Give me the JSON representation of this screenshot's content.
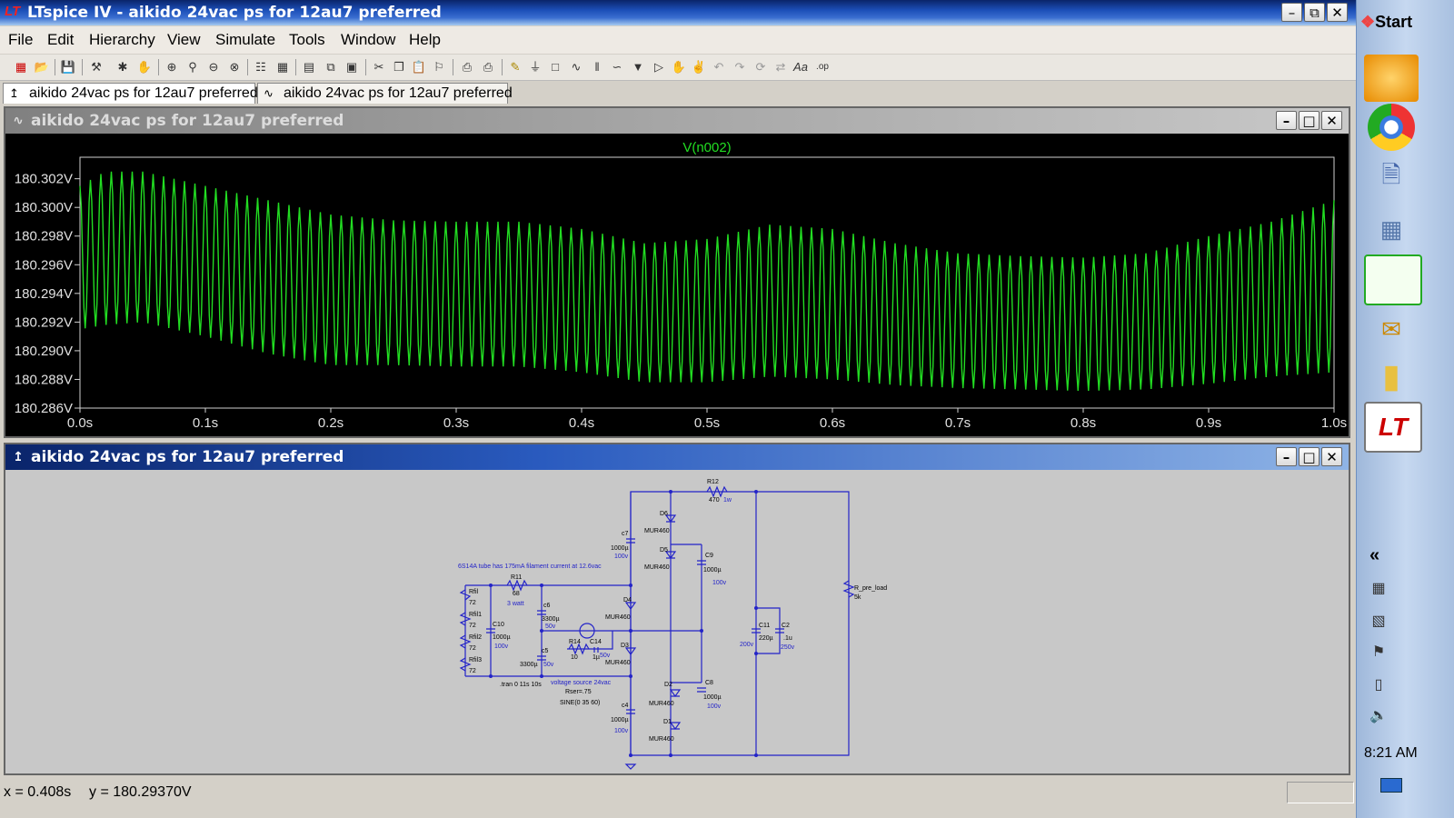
{
  "app": {
    "title": "LTspice IV - aikido 24vac ps for 12au7 preferred",
    "logo": "LT"
  },
  "menu": [
    "File",
    "Edit",
    "Hierarchy",
    "View",
    "Simulate",
    "Tools",
    "Window",
    "Help"
  ],
  "tabs": [
    {
      "label": "aikido 24vac ps for 12au7 preferred",
      "icon": "schematic-icon"
    },
    {
      "label": "aikido 24vac ps for 12au7 preferred",
      "icon": "waveform-icon"
    }
  ],
  "plot_window": {
    "title": "aikido 24vac ps for 12au7 preferred"
  },
  "schematic_window": {
    "title": "aikido 24vac ps for 12au7 preferred"
  },
  "chart_data": {
    "type": "line",
    "title": "V(n002)",
    "series": [
      {
        "name": "V(n002)",
        "color": "#22dd22"
      }
    ],
    "x_range": [
      0.0,
      1.0
    ],
    "y_range": [
      180.286,
      180.3035
    ],
    "x_ticks": [
      "0.0s",
      "0.1s",
      "0.2s",
      "0.3s",
      "0.4s",
      "0.5s",
      "0.6s",
      "0.7s",
      "0.8s",
      "0.9s",
      "1.0s"
    ],
    "y_ticks": [
      "180.302V",
      "180.300V",
      "180.298V",
      "180.296V",
      "180.294V",
      "180.292V",
      "180.290V",
      "180.288V",
      "180.286V"
    ],
    "y_tick_values": [
      180.302,
      180.3,
      180.298,
      180.296,
      180.294,
      180.292,
      180.29,
      180.288,
      180.286
    ],
    "ripple_cycles": 120,
    "envelope": {
      "x": [
        0.0,
        0.02,
        0.05,
        0.1,
        0.15,
        0.2,
        0.25,
        0.3,
        0.35,
        0.4,
        0.45,
        0.5,
        0.55,
        0.6,
        0.65,
        0.7,
        0.75,
        0.8,
        0.85,
        0.9,
        0.95,
        1.0
      ],
      "max": [
        180.3015,
        180.3025,
        180.3025,
        180.3015,
        180.3005,
        180.2995,
        180.2991,
        180.299,
        180.299,
        180.2985,
        180.2975,
        180.2978,
        180.2988,
        180.2985,
        180.2975,
        180.2968,
        180.2966,
        180.2965,
        180.2968,
        180.298,
        180.299,
        180.3005
      ],
      "min": [
        180.2915,
        180.2918,
        180.292,
        180.291,
        180.2898,
        180.289,
        180.289,
        180.2889,
        180.2889,
        180.2885,
        180.2878,
        180.2878,
        180.2882,
        180.288,
        180.2876,
        180.2874,
        180.2873,
        180.2872,
        180.2873,
        180.2877,
        180.2882,
        180.2885
      ]
    }
  },
  "schematic": {
    "labels": {
      "r12": "R12",
      "r12v": "470",
      "r12w": "1w",
      "d6": "D6",
      "mur1": "MUR460",
      "d5": "D5",
      "mur2": "MUR460",
      "c7": "c7",
      "c7v": "1000µ",
      "c7w": "100v",
      "c9": "C9",
      "c9v": "1000µ",
      "c9w": "100v",
      "note": "6S14A tube has 175mA filament current at 12.6vac",
      "r11": "R11",
      "r11v": "68",
      "r11w": "3 watt",
      "d4": "D4",
      "mur3": "MUR460",
      "c6": "c6",
      "c6v": "3300µ",
      "c6w": "50v",
      "c10": "C10",
      "c10v": "1000µ",
      "c10w": "100v",
      "rfil": "Rfil",
      "rfil1": "Rfil1",
      "rfil2": "Rfil2",
      "rfil3": "Rfil3",
      "r72a": "72",
      "r72b": "72",
      "r72c": "72",
      "r72d": "72",
      "r14": "R14",
      "r14v": "10",
      "c14": "C14",
      "c14v": "1µ",
      "c14w": "50v",
      "c5": "c5",
      "c5v": "3300µ",
      "c5w": "50v",
      "d3": "D3",
      "mur4": "MUR460",
      "tran": ".tran 0 11s 10s",
      "vs": "voltage source 24vac",
      "rser": "Rser=.75",
      "sine": "SINE(0 35 60)",
      "d2": "D2",
      "mur5": "MUR460",
      "c8": "C8",
      "c8v": "1000µ",
      "c8w": "100v",
      "c4": "c4",
      "c4v": "1000µ",
      "c4w": "100v",
      "d1": "D1",
      "mur6": "MUR460",
      "c11": "C11",
      "c11v": "220µ",
      "c11w": "200v",
      "c2": "C2",
      "c2v": ".1u",
      "c2w": "250v",
      "rpre": "R_pre_load",
      "rprev": "5k"
    }
  },
  "status": {
    "x": "x = 0.408s",
    "y": "y = 180.29370V"
  },
  "taskbar": {
    "start": "Start",
    "time": "8:21 AM",
    "collapse": "«"
  }
}
